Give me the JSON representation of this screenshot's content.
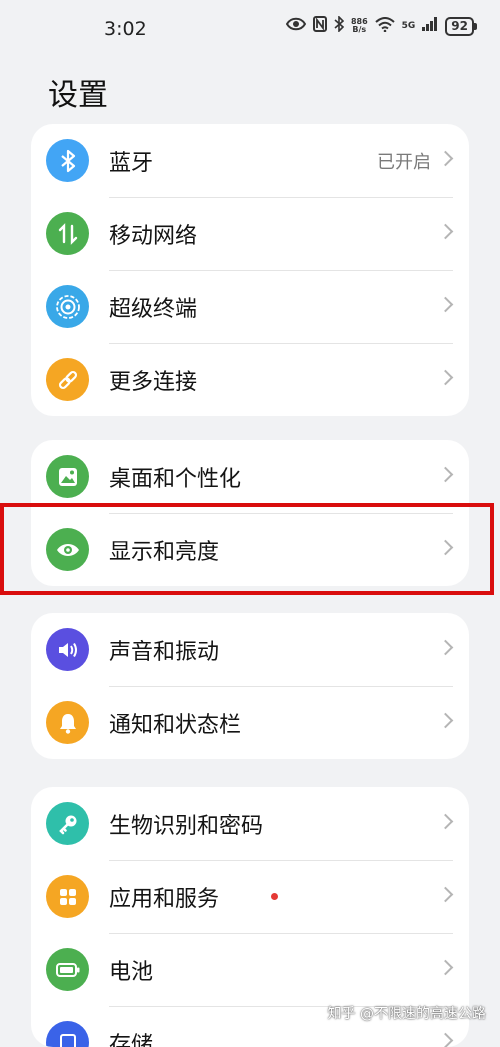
{
  "status_bar": {
    "time": "3:02",
    "net_speed_value": "886",
    "net_speed_unit": "B/s",
    "network": "5G",
    "battery": "92"
  },
  "page_title": "设置",
  "groups": [
    {
      "items": [
        {
          "label": "蓝牙",
          "value": "已开启",
          "icon": "bluetooth-icon",
          "color": "#42a5f5"
        },
        {
          "label": "移动网络",
          "icon": "mobile-data-icon",
          "color": "#4caf50"
        },
        {
          "label": "超级终端",
          "icon": "super-device-icon",
          "color": "#39a8e8"
        },
        {
          "label": "更多连接",
          "icon": "link-icon",
          "color": "#f5a623"
        }
      ]
    },
    {
      "items": [
        {
          "label": "桌面和个性化",
          "icon": "wallpaper-icon",
          "color": "#4caf50"
        },
        {
          "label": "显示和亮度",
          "icon": "eye-icon",
          "color": "#4caf50"
        }
      ]
    },
    {
      "items": [
        {
          "label": "声音和振动",
          "icon": "volume-icon",
          "color": "#5a4fe0"
        },
        {
          "label": "通知和状态栏",
          "icon": "bell-icon",
          "color": "#f5a623"
        }
      ]
    },
    {
      "items": [
        {
          "label": "生物识别和密码",
          "icon": "key-icon",
          "color": "#2fbfaa"
        },
        {
          "label": "应用和服务",
          "icon": "apps-icon",
          "color": "#f5a623"
        },
        {
          "label": "电池",
          "icon": "battery-icon",
          "color": "#4caf50"
        },
        {
          "label": "存储",
          "icon": "storage-icon",
          "color": "#3a63e8"
        }
      ]
    }
  ],
  "highlight_color": "#d90d0d",
  "watermark": "知乎 @不限速的高速公路"
}
